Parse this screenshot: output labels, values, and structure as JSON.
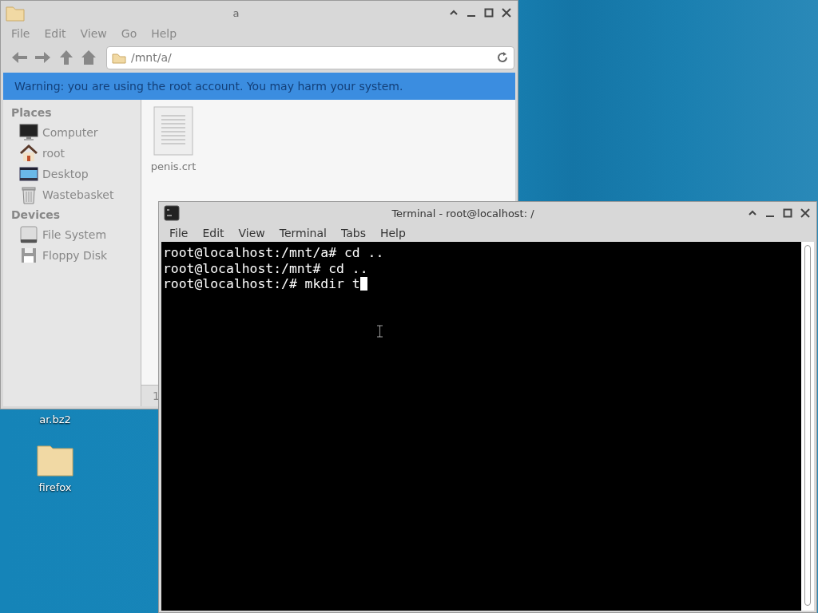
{
  "desktop": {
    "icons": [
      {
        "label": "ar.bz2",
        "kind": "hidden"
      },
      {
        "label": "firefox",
        "kind": "folder"
      }
    ]
  },
  "file_manager": {
    "title": "a",
    "menu": [
      "File",
      "Edit",
      "View",
      "Go",
      "Help"
    ],
    "location": "/mnt/a/",
    "warning": "Warning: you are using the root account. You may harm your system.",
    "sidebar": [
      {
        "heading": "Places",
        "items": [
          {
            "label": "Computer",
            "kind": "computer"
          },
          {
            "label": "root",
            "kind": "home"
          },
          {
            "label": "Desktop",
            "kind": "desktop"
          },
          {
            "label": "Wastebasket",
            "kind": "trash"
          }
        ]
      },
      {
        "heading": "Devices",
        "items": [
          {
            "label": "File System",
            "kind": "drive"
          },
          {
            "label": "Floppy Disk",
            "kind": "floppy"
          }
        ]
      }
    ],
    "files": [
      {
        "name": "penis.crt",
        "kind": "document"
      }
    ],
    "status_bar": "1"
  },
  "terminal": {
    "title": "Terminal - root@localhost: /",
    "menu": [
      "File",
      "Edit",
      "View",
      "Terminal",
      "Tabs",
      "Help"
    ],
    "lines": [
      "root@localhost:/mnt/a# cd ..",
      "root@localhost:/mnt# cd ..",
      "root@localhost:/# mkdir t"
    ],
    "cursor_visible": true
  }
}
